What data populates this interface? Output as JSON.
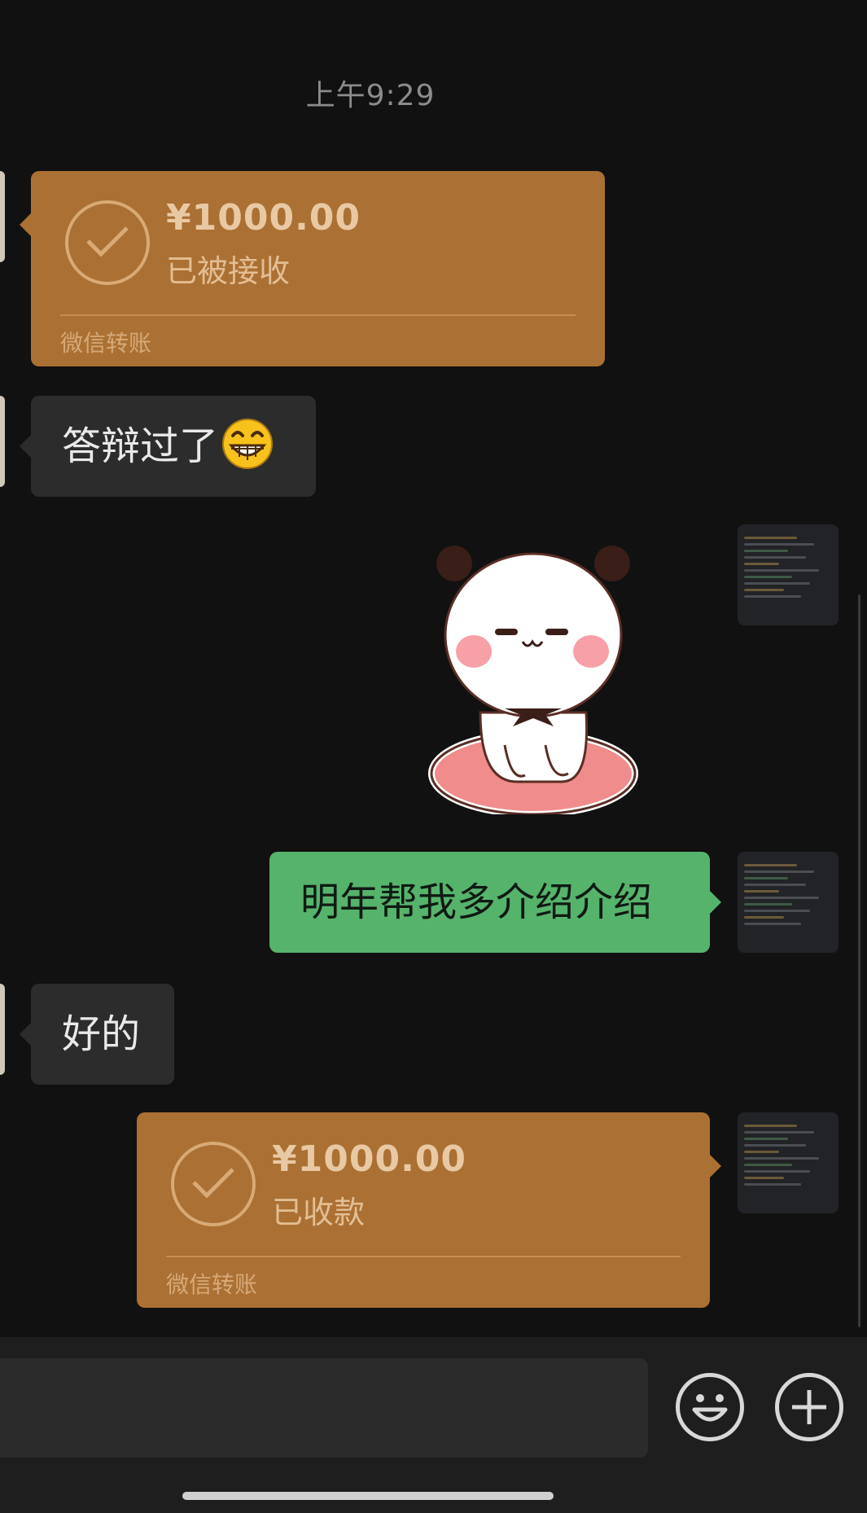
{
  "chat": {
    "timestamp": "上午9:29",
    "messages": [
      {
        "type": "transfer",
        "side": "left",
        "amount": "¥1000.00",
        "status": "已被接收",
        "footer": "微信转账"
      },
      {
        "type": "text",
        "side": "left",
        "text": "答辩过了",
        "emoji": "grinning-face-icon"
      },
      {
        "type": "sticker",
        "side": "right",
        "sticker": "panda-sitting-on-cushion-sticker"
      },
      {
        "type": "text",
        "side": "right",
        "text": "明年帮我多介绍介绍"
      },
      {
        "type": "text",
        "side": "left",
        "text": "好的"
      },
      {
        "type": "transfer",
        "side": "right",
        "amount": "¥1000.00",
        "status": "已收款",
        "footer": "微信转账"
      }
    ]
  },
  "input_bar": {
    "placeholder": "",
    "emoji_button_icon": "smiley-icon",
    "more_button_icon": "plus-circle-icon"
  },
  "colors": {
    "background": "#111111",
    "transfer_card": "#ab7033",
    "sent_bubble": "#56b36c",
    "received_bubble": "#2c2c2c"
  }
}
